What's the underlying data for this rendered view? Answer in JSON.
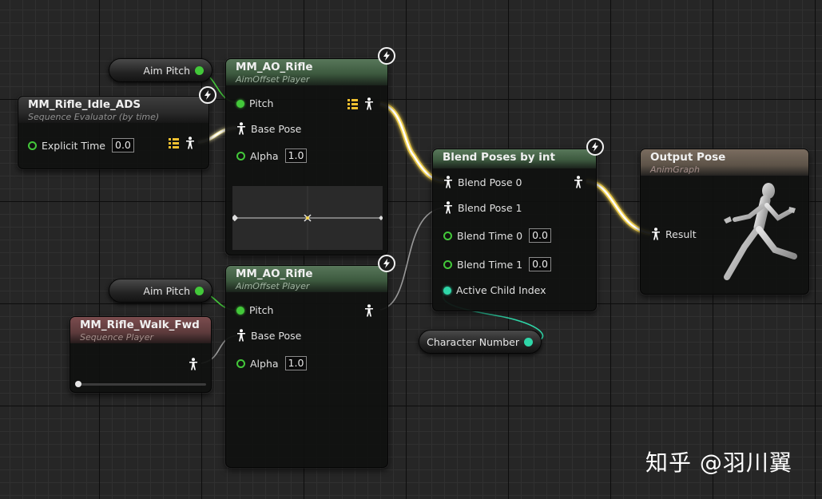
{
  "watermark": "知乎 @羽川翼",
  "vars": {
    "aim_pitch_1": "Aim Pitch",
    "aim_pitch_2": "Aim Pitch",
    "character_number": "Character Number"
  },
  "seq_eval": {
    "title": "MM_Rifle_Idle_ADS",
    "subtitle": "Sequence Evaluator (by time)",
    "explicit_time_label": "Explicit Time",
    "explicit_time_value": "0.0"
  },
  "ao_top": {
    "title": "MM_AO_Rifle",
    "subtitle": "AimOffset Player",
    "pitch": "Pitch",
    "base_pose": "Base Pose",
    "alpha_label": "Alpha",
    "alpha_value": "1.0"
  },
  "ao_bottom": {
    "title": "MM_AO_Rifle",
    "subtitle": "AimOffset Player",
    "pitch": "Pitch",
    "base_pose": "Base Pose",
    "alpha_label": "Alpha",
    "alpha_value": "1.0"
  },
  "seq_player": {
    "title": "MM_Rifle_Walk_Fwd",
    "subtitle": "Sequence Player"
  },
  "blend": {
    "title": "Blend Poses by int",
    "blend_pose_0": "Blend Pose 0",
    "blend_pose_1": "Blend Pose 1",
    "blend_time_0_label": "Blend Time 0",
    "blend_time_0_value": "0.0",
    "blend_time_1_label": "Blend Time 1",
    "blend_time_1_value": "0.0",
    "active_child_index": "Active Child Index"
  },
  "output": {
    "title": "Output Pose",
    "subtitle": "AnimGraph",
    "result": "Result"
  },
  "colors": {
    "float_pin": "#43c83a",
    "int_pin": "#2fd6a8",
    "pose_wire": "#ffffff",
    "active_wire": "#f2d24a"
  },
  "icons": {
    "pose": "pose-pin-icon",
    "bolt": "fast-path-bolt-icon",
    "list": "list-icon"
  }
}
